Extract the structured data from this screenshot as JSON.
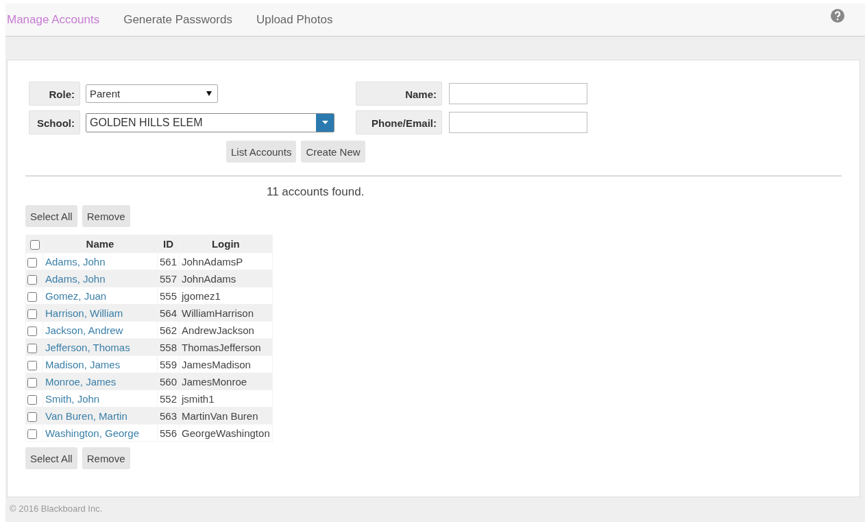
{
  "nav": {
    "tabs": [
      {
        "label": "Manage Accounts",
        "selected": true
      },
      {
        "label": "Generate Passwords",
        "selected": false
      },
      {
        "label": "Upload Photos",
        "selected": false
      }
    ]
  },
  "form": {
    "role": {
      "label": "Role:",
      "value": "Parent"
    },
    "school": {
      "label": "School:",
      "value": "GOLDEN HILLS ELEM"
    },
    "name": {
      "label": "Name:"
    },
    "phone_email": {
      "label": "Phone/Email:"
    },
    "buttons": [
      "List Accounts",
      "Create New"
    ]
  },
  "result_message": "11 accounts found.",
  "top_actions": [
    "Select All",
    "Remove"
  ],
  "table": {
    "header_checked": false,
    "columns": [
      "Name",
      "ID",
      "Login"
    ],
    "rows": [
      {
        "name": "Adams, John",
        "id": "561",
        "login": "JohnAdamsP",
        "checked": false
      },
      {
        "name": "Adams, John",
        "id": "557",
        "login": "JohnAdams",
        "checked": false
      },
      {
        "name": "Gomez, Juan",
        "id": "555",
        "login": "jgomez1",
        "checked": false
      },
      {
        "name": "Harrison, William",
        "id": "564",
        "login": "WilliamHarrison",
        "checked": false
      },
      {
        "name": "Jackson, Andrew",
        "id": "562",
        "login": "AndrewJackson",
        "checked": false
      },
      {
        "name": "Jefferson, Thomas",
        "id": "558",
        "login": "ThomasJefferson",
        "checked": false
      },
      {
        "name": "Madison, James",
        "id": "559",
        "login": "JamesMadison",
        "checked": false
      },
      {
        "name": "Monroe, James",
        "id": "560",
        "login": "JamesMonroe",
        "checked": false
      },
      {
        "name": "Smith, John",
        "id": "552",
        "login": "jsmith1",
        "checked": false
      },
      {
        "name": "Van Buren, Martin",
        "id": "563",
        "login": "MartinVan Buren",
        "checked": false
      },
      {
        "name": "Washington, George",
        "id": "556",
        "login": "GeorgeWashington",
        "checked": false
      }
    ]
  },
  "bottom_actions": [
    "Select All",
    "Remove"
  ],
  "footer": "© 2016 Blackboard Inc."
}
